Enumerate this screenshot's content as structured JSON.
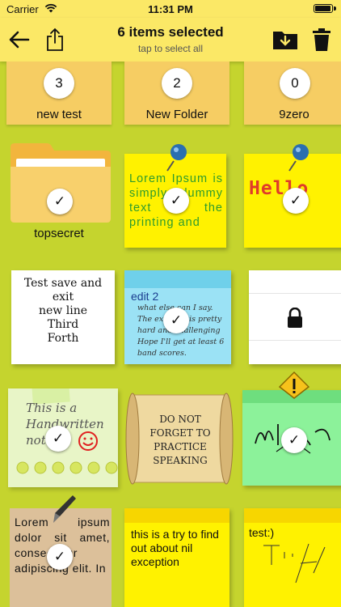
{
  "status_bar": {
    "carrier": "Carrier",
    "time": "11:31 PM"
  },
  "header": {
    "title": "6 items selected",
    "subtitle": "tap to select all"
  },
  "folders": [
    {
      "count": "3",
      "name": "new test"
    },
    {
      "count": "2",
      "name": "New Folder"
    },
    {
      "count": "0",
      "name": "9zero"
    }
  ],
  "folder_locked_name": "topsecret",
  "notes": {
    "lorem_green": "Lorem Ipsum is simply dummy text of the printing and",
    "hello": "Hello",
    "test_save": "Test save and exit\nnew line\nThird\nForth",
    "edit2_title": "edit 2",
    "edit2_body": "what else can I say. The exercise is pretty hard and challenging Hope I'll get at least 6 band scores.",
    "handwritten": "This is a Handwritten note",
    "scroll": "DO NOT FORGET TO PRACTICE SPEAKING",
    "lorem_paper": "Lorem ipsum dolor sit amet, consectetur adipiscing elit. In",
    "nil_exception": "this is a try to find out about nil exception",
    "test_smile": "test:)"
  },
  "check_mark": "✓"
}
